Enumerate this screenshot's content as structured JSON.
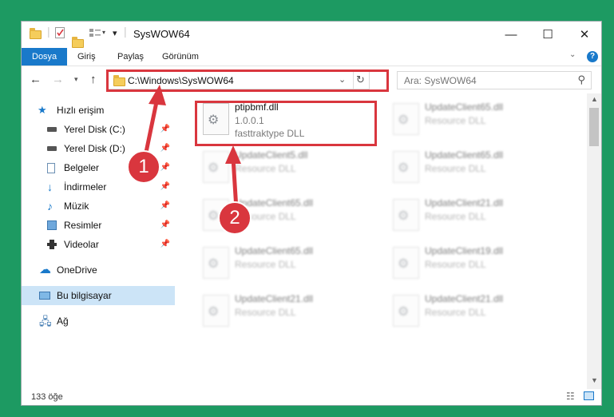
{
  "window": {
    "title": "SysWOW64"
  },
  "ribbon": {
    "tabs": [
      "Dosya",
      "Giriş",
      "Paylaş",
      "Görünüm"
    ]
  },
  "address": {
    "path": "C:\\Windows\\SysWOW64"
  },
  "search": {
    "placeholder": "Ara: SysWOW64"
  },
  "sidebar": {
    "items": [
      {
        "label": "Hızlı erişim",
        "icon": "star-icon"
      },
      {
        "label": "Yerel Disk (C:)",
        "icon": "drive-icon"
      },
      {
        "label": "Yerel Disk (D:)",
        "icon": "drive-icon"
      },
      {
        "label": "Belgeler",
        "icon": "documents-icon"
      },
      {
        "label": "İndirmeler",
        "icon": "download-icon"
      },
      {
        "label": "Müzik",
        "icon": "music-icon"
      },
      {
        "label": "Resimler",
        "icon": "pictures-icon"
      },
      {
        "label": "Videolar",
        "icon": "videos-icon"
      },
      {
        "label": "OneDrive",
        "icon": "cloud-icon"
      },
      {
        "label": "Bu bilgisayar",
        "icon": "computer-icon"
      },
      {
        "label": "Ağ",
        "icon": "network-icon"
      }
    ]
  },
  "files": [
    {
      "name": "ptipbmf.dll",
      "line2": "1.0.0.1",
      "line3": "fasttraktype DLL",
      "highlight": true
    },
    {
      "name": "UpdateClient65.dll",
      "line2": "Resource DLL"
    },
    {
      "name": "UpdateClient5.dll",
      "line2": "Resource DLL"
    },
    {
      "name": "UpdateClient65.dll",
      "line2": "Resource DLL"
    },
    {
      "name": "UpdateClient65.dll",
      "line2": "Resource DLL"
    },
    {
      "name": "UpdateClient21.dll",
      "line2": "Resource DLL"
    },
    {
      "name": "UpdateClient65.dll",
      "line2": "Resource DLL"
    },
    {
      "name": "UpdateClient19.dll",
      "line2": "Resource DLL"
    },
    {
      "name": "UpdateClient21.dll",
      "line2": "Resource DLL"
    },
    {
      "name": "UpdateClient21.dll",
      "line2": "Resource DLL"
    }
  ],
  "status": {
    "count": "133 öğe"
  },
  "annotations": {
    "step1": "1",
    "step2": "2"
  },
  "colors": {
    "accent": "#1979ca",
    "annotation": "#d9363e",
    "background": "#1d9a62"
  }
}
